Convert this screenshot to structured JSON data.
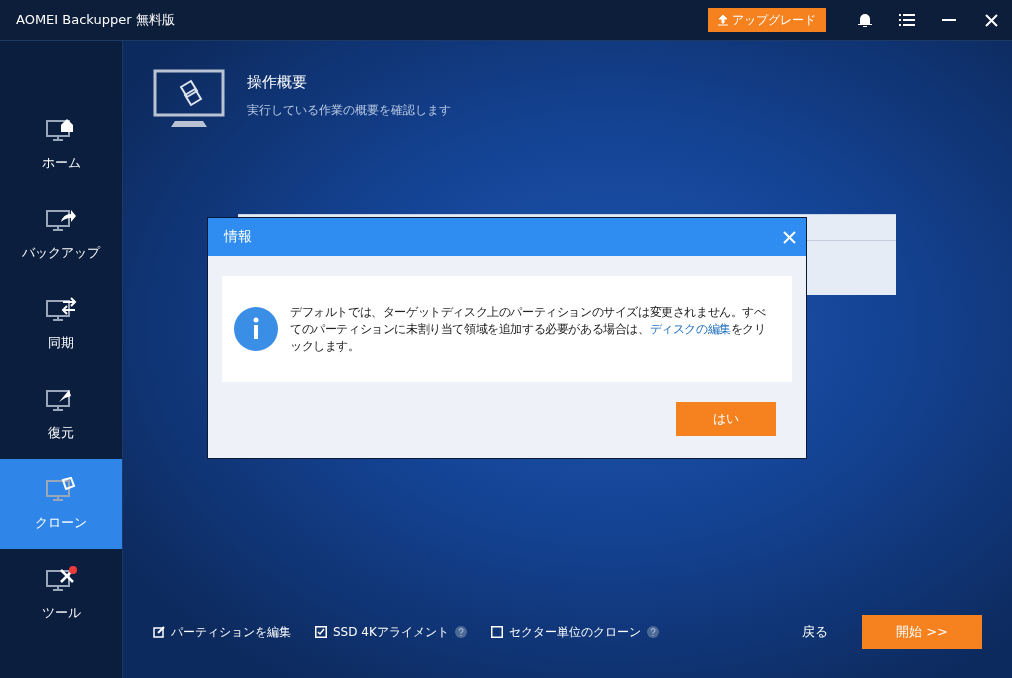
{
  "window": {
    "title": "AOMEI Backupper 無料版",
    "upgrade": "アップグレード"
  },
  "sidebar": {
    "items": [
      {
        "label": "ホーム",
        "kind": "home",
        "selected": false,
        "badge": false
      },
      {
        "label": "バックアップ",
        "kind": "backup",
        "selected": false,
        "badge": false
      },
      {
        "label": "同期",
        "kind": "sync",
        "selected": false,
        "badge": false
      },
      {
        "label": "復元",
        "kind": "restore",
        "selected": false,
        "badge": false
      },
      {
        "label": "クローン",
        "kind": "clone",
        "selected": true,
        "badge": false
      },
      {
        "label": "ツール",
        "kind": "tools",
        "selected": false,
        "badge": true
      }
    ]
  },
  "header": {
    "title": "操作概要",
    "subtitle": "実行している作業の概要を確認します"
  },
  "dialog": {
    "title": "情報",
    "message_before": "デフォルトでは、ターゲットディスク上のパーティションのサイズは変更されません。すべてのパーティションに未割り当て領域を追加する必要がある場合は、",
    "link": "ディスクの編集",
    "message_after": "をクリックします。",
    "button": "はい"
  },
  "options": [
    {
      "label": "パーティションを編集",
      "kind": "edit",
      "checked": true,
      "help": false
    },
    {
      "label": "SSD 4Kアライメント",
      "kind": "checkbox",
      "checked": true,
      "help": true
    },
    {
      "label": "セクター単位のクローン",
      "kind": "checkbox",
      "checked": false,
      "help": true
    }
  ],
  "footer": {
    "back": "戻る",
    "start": "開始 >>"
  }
}
